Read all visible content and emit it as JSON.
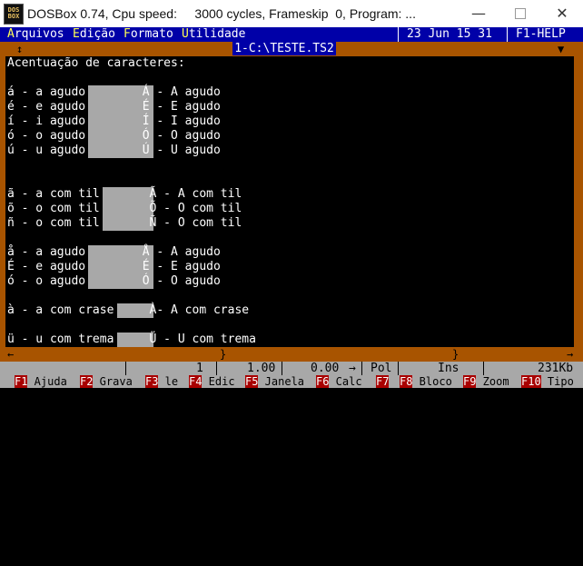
{
  "window": {
    "title": "DOSBox 0.74, Cpu speed:     3000 cycles, Frameskip  0, Program: ...",
    "icon_text": "DOS\nBOX",
    "controls": {
      "minimize": "—",
      "close": "✕"
    }
  },
  "menu": {
    "items": [
      {
        "hotkey": "A",
        "rest": "rquivos"
      },
      {
        "hotkey": "E",
        "rest": "dição"
      },
      {
        "hotkey": "F",
        "rest": "ormato"
      },
      {
        "hotkey": "U",
        "rest": "tilidade"
      }
    ],
    "date": "23 Jun 15 31",
    "help": "F1-HELP"
  },
  "editor": {
    "filename": "1-C:\\TESTE.TS2",
    "top_marks": {
      "left": "↕",
      "tab": "▼"
    },
    "lines": [
      "Acentuação de caracteres:",
      "",
      "á - a agudo        Á - A agudo",
      "é - e agudo        É - E agudo",
      "í - i agudo        Í - I agudo",
      "ó - o agudo        Ó - O agudo",
      "ú - u agudo        Ú - U agudo",
      "",
      "",
      "ã - a com til       Ã - A com til",
      "õ - o com til       Õ - O com til",
      "ñ - o com til       Ñ - O com til",
      "",
      "å - a agudo        Å - A agudo",
      "É - e agudo        É - E agudo",
      "ó - o agudo        Ó - O agudo",
      "",
      "à - a com crase     À- A com crase",
      "",
      "ü - u com trema     Ü - U com trema"
    ],
    "bottom_marks": {
      "left": "←",
      "right": "→",
      "tab1": "}",
      "tab2": "}"
    }
  },
  "status": {
    "line": "1",
    "col": "1.00",
    "pos": "0.00",
    "arrow": "→",
    "mode1": "Pol",
    "mode2": "Ins",
    "memory": "231Kb"
  },
  "function_keys": [
    {
      "key": "F1",
      "label": " Ajuda"
    },
    {
      "key": "F2",
      "label": " Grava"
    },
    {
      "key": "F3",
      "label": " le"
    },
    {
      "key": "F4",
      "label": " Edic"
    },
    {
      "key": "F5",
      "label": " Janela"
    },
    {
      "key": "F6",
      "label": " Calc"
    },
    {
      "key": "F7",
      "label": " "
    },
    {
      "key": "F8",
      "label": " Bloco"
    },
    {
      "key": "F9",
      "label": " Zoom"
    },
    {
      "key": "F10",
      "label": " Tipo"
    }
  ]
}
